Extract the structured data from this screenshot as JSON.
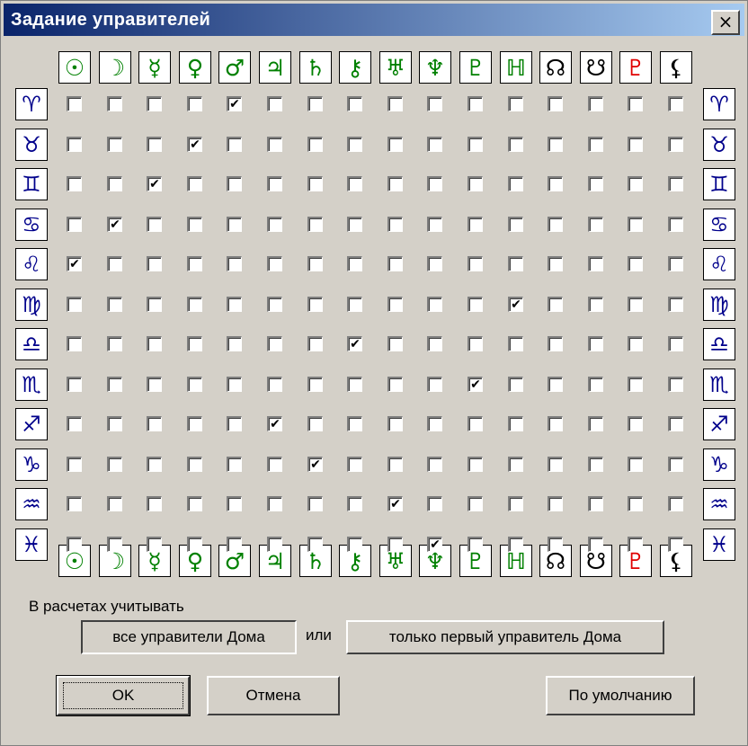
{
  "window": {
    "title": "Задание управителей",
    "close_label": "×"
  },
  "planets": [
    {
      "name": "sun",
      "symbol": "☉",
      "color": "#008000"
    },
    {
      "name": "moon",
      "symbol": "☽",
      "color": "#008000"
    },
    {
      "name": "mercury",
      "symbol": "☿",
      "color": "#008000"
    },
    {
      "name": "venus",
      "symbol": "♀",
      "color": "#008000"
    },
    {
      "name": "mars",
      "symbol": "♂",
      "color": "#008000"
    },
    {
      "name": "jupiter",
      "symbol": "♃",
      "color": "#008000"
    },
    {
      "name": "saturn",
      "symbol": "♄",
      "color": "#008000"
    },
    {
      "name": "chiron",
      "symbol": "⚷",
      "color": "#008000"
    },
    {
      "name": "uranus",
      "symbol": "♅",
      "color": "#008000"
    },
    {
      "name": "neptune",
      "symbol": "♆",
      "color": "#008000"
    },
    {
      "name": "pluto",
      "symbol": "♇",
      "color": "#008000"
    },
    {
      "name": "proserpina",
      "symbol": "ℍ",
      "color": "#008000"
    },
    {
      "name": "north-node",
      "symbol": "☊",
      "color": "#000000"
    },
    {
      "name": "south-node",
      "symbol": "☋",
      "color": "#000000"
    },
    {
      "name": "red-planet",
      "symbol": "♇",
      "color": "#e00000"
    },
    {
      "name": "black-moon",
      "symbol": "⚸",
      "color": "#000000"
    }
  ],
  "signs": [
    {
      "name": "aries",
      "symbol": "♈"
    },
    {
      "name": "taurus",
      "symbol": "♉"
    },
    {
      "name": "gemini",
      "symbol": "♊"
    },
    {
      "name": "cancer",
      "symbol": "♋"
    },
    {
      "name": "leo",
      "symbol": "♌"
    },
    {
      "name": "virgo",
      "symbol": "♍"
    },
    {
      "name": "libra",
      "symbol": "♎"
    },
    {
      "name": "scorpio",
      "symbol": "♏"
    },
    {
      "name": "sagittarius",
      "symbol": "♐"
    },
    {
      "name": "capricorn",
      "symbol": "♑"
    },
    {
      "name": "aquarius",
      "symbol": "♒"
    },
    {
      "name": "pisces",
      "symbol": "♓"
    }
  ],
  "checked_column_per_sign": [
    4,
    3,
    2,
    1,
    0,
    11,
    7,
    10,
    5,
    6,
    8,
    9
  ],
  "options": {
    "label": "В расчетах учитывать",
    "all_rulers_label": "все управители Дома",
    "or_label": "или",
    "first_ruler_label": "только первый управитель Дома"
  },
  "buttons": {
    "ok": "OK",
    "cancel": "Отмена",
    "default": "По умолчанию"
  }
}
